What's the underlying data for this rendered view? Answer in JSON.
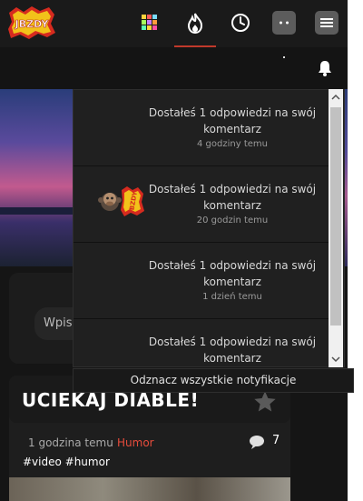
{
  "brand": {
    "logo_text": "JBZDY"
  },
  "nav": {
    "icons": [
      "grid-icon",
      "fire-icon",
      "clock-icon",
      "dice-icon",
      "menu-icon"
    ]
  },
  "notifications": {
    "items": [
      {
        "text": "Dostałeś 1 odpowiedzi na swój komentarz",
        "time": "4 godziny temu",
        "has_avatar": false
      },
      {
        "text": "Dostałeś 1 odpowiedzi na swój komentarz",
        "time": "20 godzin temu",
        "has_avatar": true
      },
      {
        "text": "Dostałeś 1 odpowiedzi na swój komentarz",
        "time": "1 dzień temu",
        "has_avatar": false
      },
      {
        "text": "Dostałeś 1 odpowiedzi na swój komentarz",
        "time": "",
        "has_avatar": false
      }
    ],
    "mark_all_label": "Odznacz wszystkie notyfikacje"
  },
  "search": {
    "placeholder": "Wpisz"
  },
  "post": {
    "title": "UCIEKAJ DIABLE!",
    "time": "1 godzina temu",
    "category": "Humor",
    "comments": "7",
    "tags": "#video #humor"
  },
  "colors": {
    "accent": "#e74c3c",
    "background": "#151515",
    "panel": "#202020"
  }
}
